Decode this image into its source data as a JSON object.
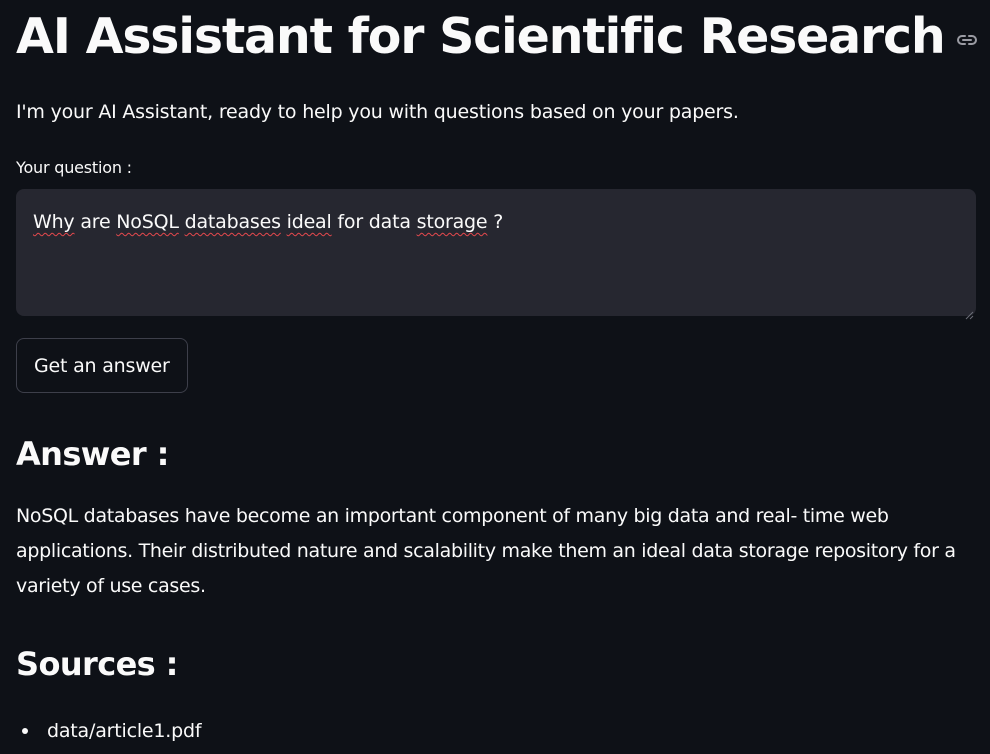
{
  "header": {
    "title": "AI Assistant for Scientific Research",
    "link_icon": "link-icon"
  },
  "intro": {
    "text": "I'm your AI Assistant, ready to help you with questions based on your papers."
  },
  "question": {
    "label": "Your question :",
    "value_words": [
      "Why",
      " are ",
      "NoSQL",
      " ",
      "databases",
      " ",
      "ideal",
      " for data ",
      "storage",
      " ?"
    ],
    "value": "Why are NoSQL databases ideal for data storage ?"
  },
  "actions": {
    "submit_label": "Get an answer"
  },
  "answer": {
    "heading": "Answer :",
    "text": "NoSQL databases have become an important component of many big data and real- time web applications. Their distributed nature and scalability make them an ideal data storage repository for a variety of use cases."
  },
  "sources": {
    "heading": "Sources :",
    "items": [
      "data/article1.pdf"
    ]
  },
  "colors": {
    "background": "#0e1117",
    "input_background": "#262730",
    "text": "#fafafa",
    "spellcheck": "#e5484d"
  }
}
